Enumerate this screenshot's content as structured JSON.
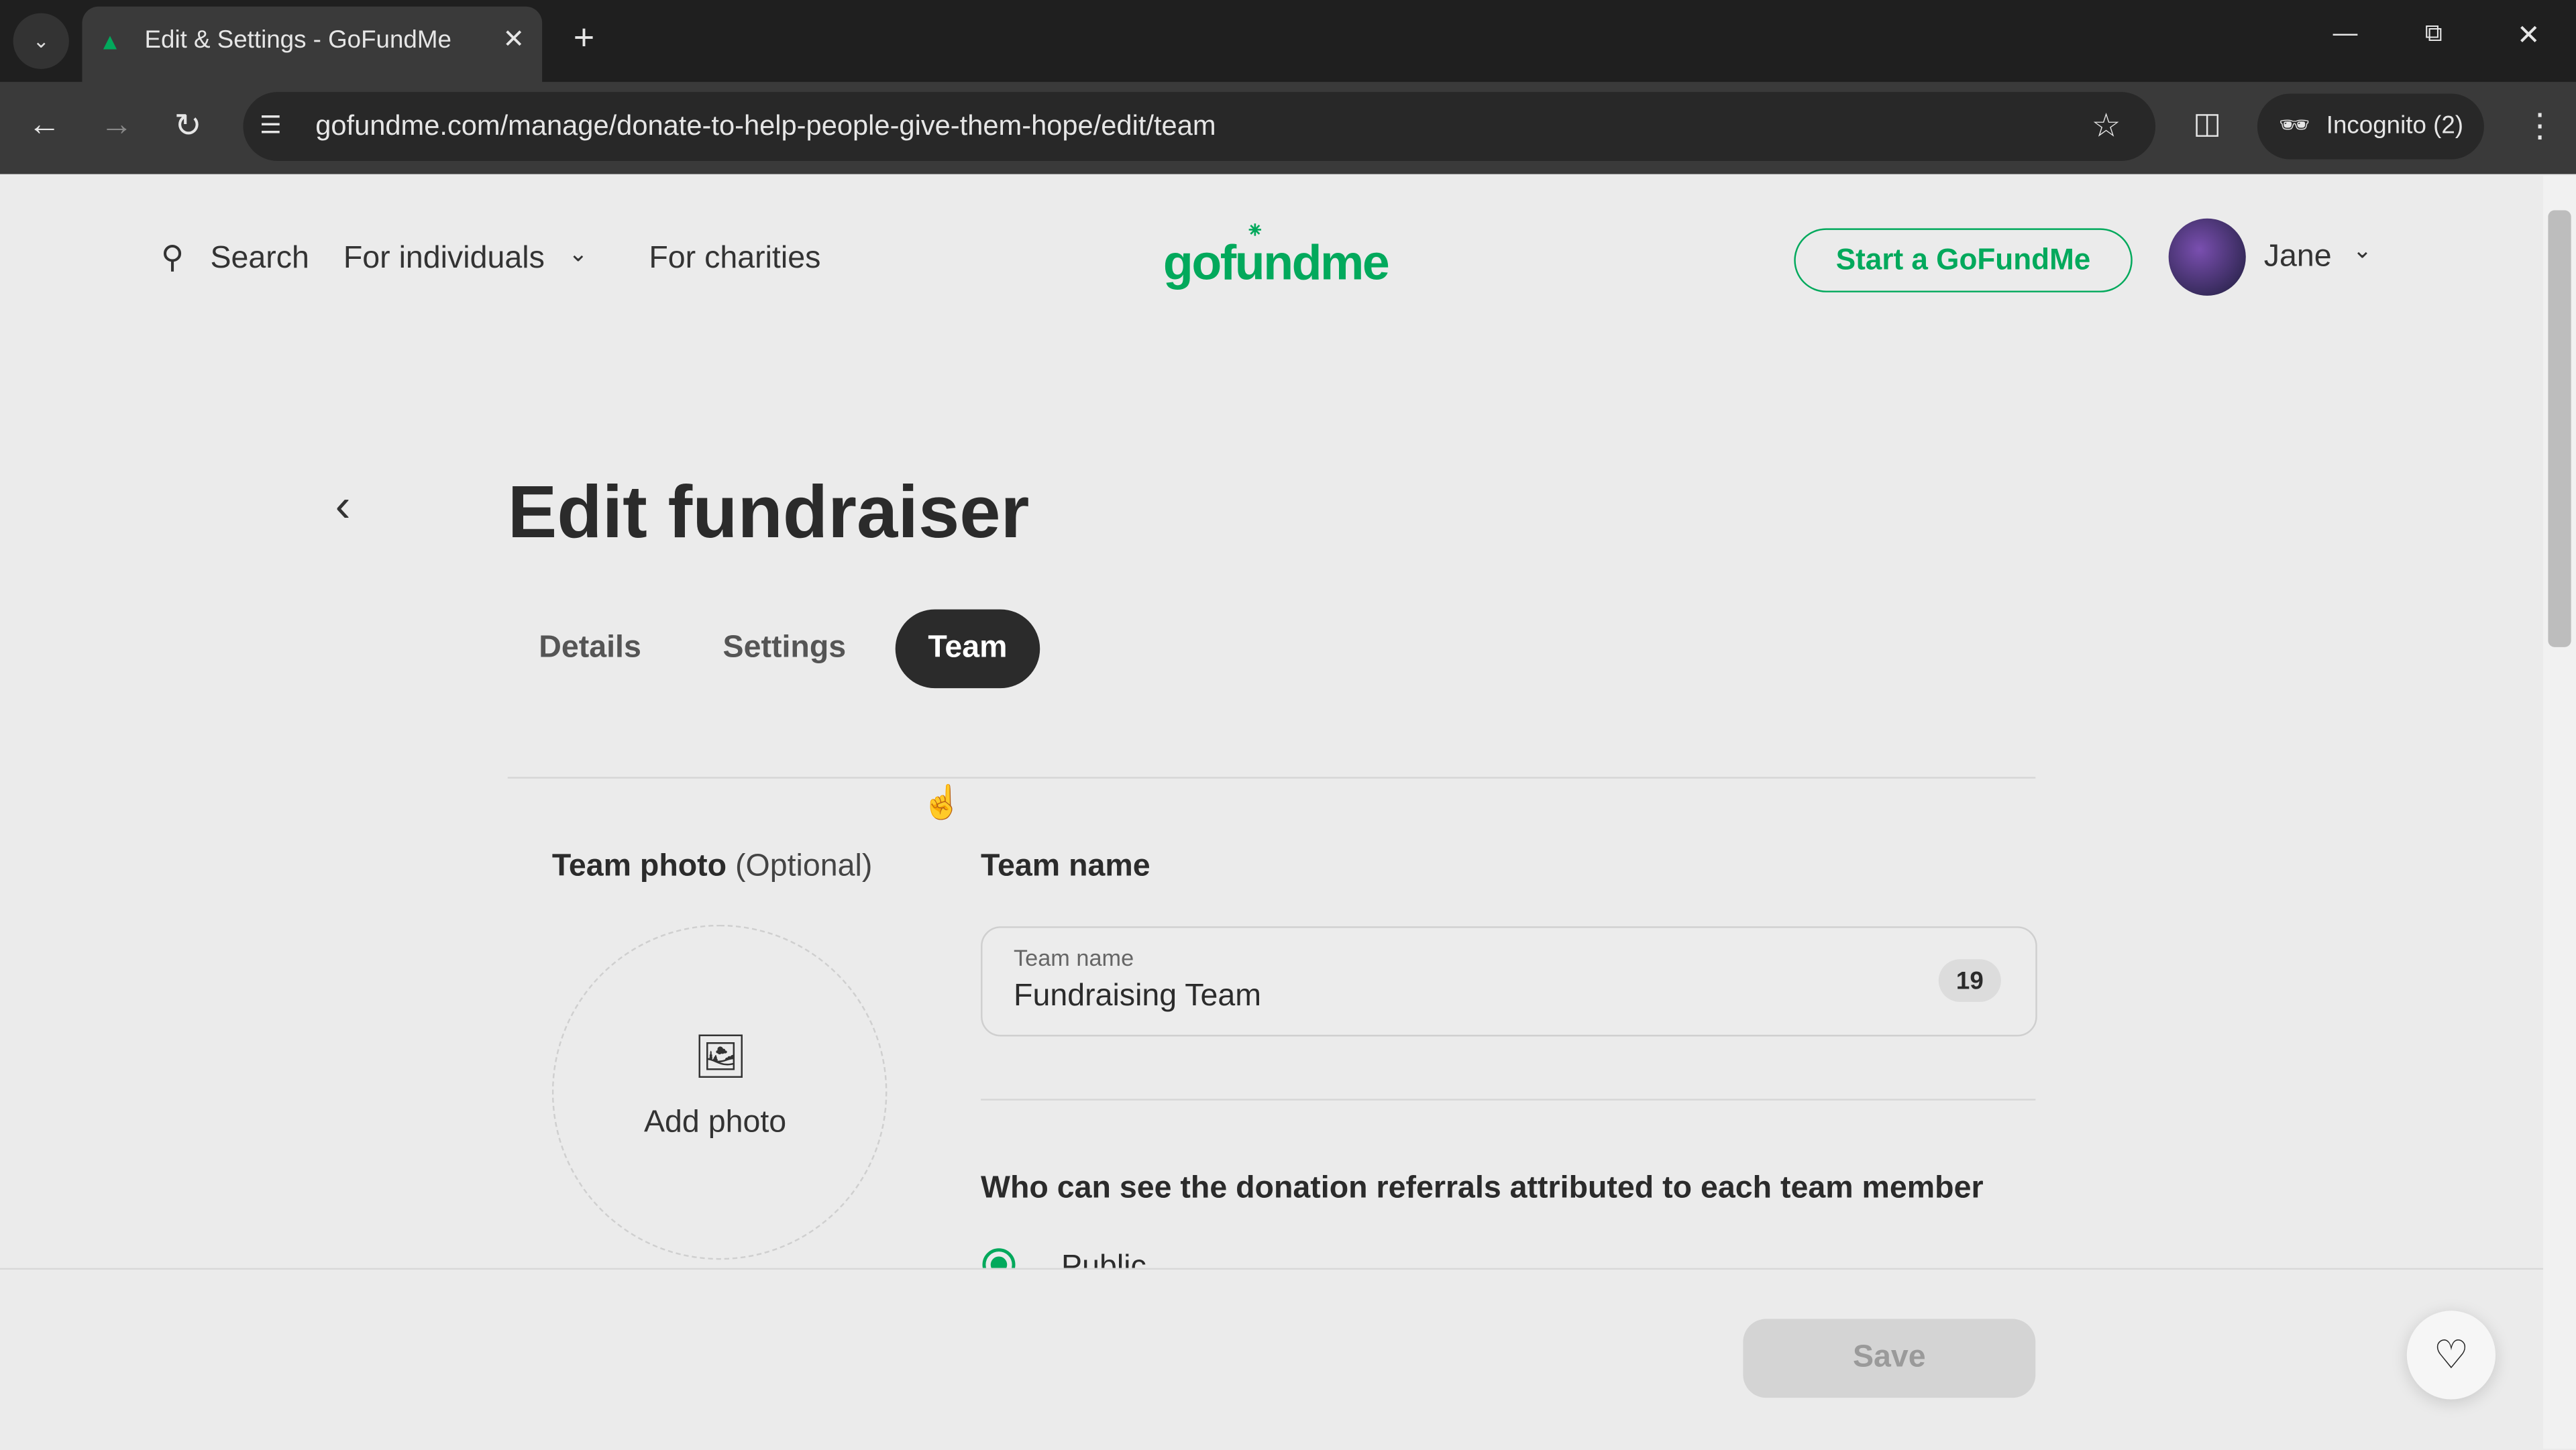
{
  "browser": {
    "tab_title": "Edit & Settings - GoFundMe",
    "url": "gofundme.com/manage/donate-to-help-people-give-them-hope/edit/team",
    "incognito_label": "Incognito (2)"
  },
  "header": {
    "search_label": "Search",
    "for_individuals": "For individuals",
    "for_charities": "For charities",
    "logo": "gofundme",
    "start_button": "Start a GoFundMe",
    "user_name": "Jane"
  },
  "main": {
    "title": "Edit fundraiser",
    "tabs": [
      {
        "label": "Details",
        "active": false
      },
      {
        "label": "Settings",
        "active": false
      },
      {
        "label": "Team",
        "active": true
      }
    ],
    "team_photo_label": "Team photo",
    "team_photo_optional": "(Optional)",
    "add_photo": "Add photo",
    "team_name_heading": "Team name",
    "team_name_field_label": "Team name",
    "team_name_value": "Fundraising Team",
    "team_name_counter": "19",
    "visibility_heading": "Who can see the donation referrals attributed to each team member",
    "visibility_options": [
      {
        "label": "Public",
        "selected": true
      }
    ],
    "save_button": "Save"
  },
  "colors": {
    "brand": "#02a95c",
    "accent_dark": "#2b2b2b"
  }
}
